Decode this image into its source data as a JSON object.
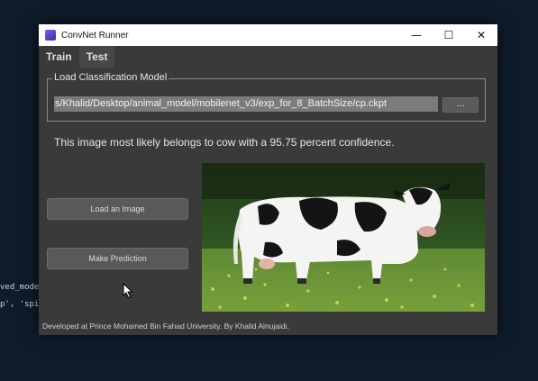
{
  "background": {
    "code_line_1": "ved_mode",
    "code_line_2": "p', 'spi"
  },
  "window": {
    "title": "ConvNet Runner",
    "icon": "app-icon",
    "controls": {
      "minimize": "—",
      "maximize": "☐",
      "close": "✕"
    }
  },
  "tabs": [
    {
      "label": "Train",
      "active": false
    },
    {
      "label": "Test",
      "active": true
    }
  ],
  "model_group": {
    "legend": "Load Classification Model",
    "path_value": "s/Khalid/Desktop/animal_model/mobilenet_v3/exp_for_8_BatchSize/cp.ckpt",
    "browse_label": "..."
  },
  "result": {
    "text": "This image most likely belongs to cow with a 95.75 percent confidence."
  },
  "buttons": {
    "load_image": "Load an Image",
    "make_prediction": "Make Prediction"
  },
  "image": {
    "subject": "cow-photo"
  },
  "footer": {
    "text": "Developed at Prince Mohamed Bin Fahad University. By Khalid Alnujaidi."
  },
  "colors": {
    "window_bg": "#3a3a3a",
    "desktop_bg": "#0d1b2a",
    "field_bg": "#7b7b7b"
  }
}
